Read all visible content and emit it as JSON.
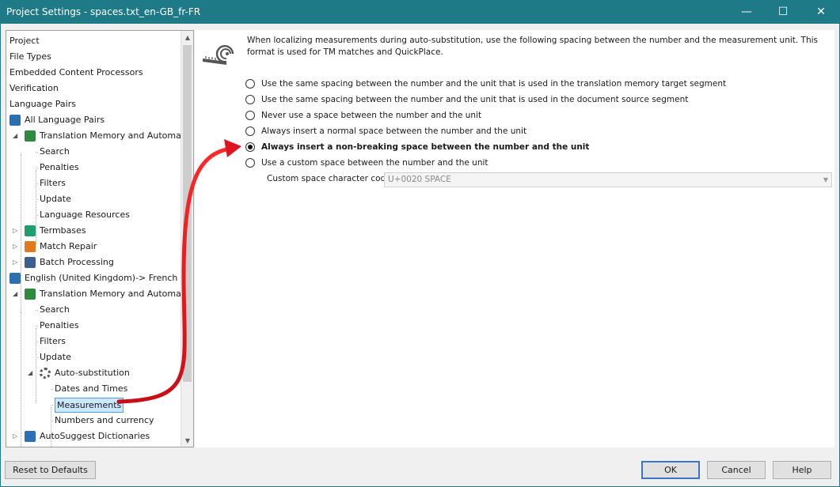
{
  "window": {
    "title": "Project Settings - spaces.txt_en-GB_fr-FR",
    "minimize": "—",
    "maximize": "☐",
    "close": "✕"
  },
  "tree": {
    "items": [
      {
        "label": "Project"
      },
      {
        "label": "File Types"
      },
      {
        "label": "Embedded Content Processors"
      },
      {
        "label": "Verification"
      },
      {
        "label": "Language Pairs"
      },
      {
        "label": "All Language Pairs",
        "icon": "language-pair-icon"
      },
      {
        "label": "Translation Memory and Automate",
        "icon": "translation-memory-icon"
      },
      {
        "label": "Search"
      },
      {
        "label": "Penalties"
      },
      {
        "label": "Filters"
      },
      {
        "label": "Update"
      },
      {
        "label": "Language Resources"
      },
      {
        "label": "Termbases",
        "icon": "termbase-icon"
      },
      {
        "label": "Match Repair",
        "icon": "wrench-icon"
      },
      {
        "label": "Batch Processing",
        "icon": "batch-icon"
      },
      {
        "label": "English (United Kingdom)-> French (Fr",
        "icon": "language-pair-icon"
      },
      {
        "label": "Translation Memory and Automate",
        "icon": "translation-memory-icon"
      },
      {
        "label": "Search"
      },
      {
        "label": "Penalties"
      },
      {
        "label": "Filters"
      },
      {
        "label": "Update"
      },
      {
        "label": "Auto-substitution",
        "icon": "gear-icon"
      },
      {
        "label": "Dates and Times"
      },
      {
        "label": "Measurements"
      },
      {
        "label": "Numbers and currency"
      },
      {
        "label": "AutoSuggest Dictionaries",
        "icon": "dictionary-icon"
      },
      {
        "label": "Match Repair",
        "icon": "wrench-icon"
      }
    ],
    "selected": "Measurements"
  },
  "content": {
    "description": "When localizing measurements during auto-substitution, use the following spacing between the number and the measurement unit. This format is used for TM matches and QuickPlace.",
    "options": [
      {
        "label": "Use the same spacing between the number and the unit that is used in the translation memory target segment",
        "checked": false
      },
      {
        "label": "Use the same spacing between the number and the unit that is used in the document source segment",
        "checked": false
      },
      {
        "label": "Never use a space between the number and the unit",
        "checked": false
      },
      {
        "label": "Always insert a normal space between the number and the unit",
        "checked": false
      },
      {
        "label": "Always insert a non-breaking space between the number and the unit",
        "checked": true
      },
      {
        "label": "Use a custom space between the number and the unit",
        "checked": false
      }
    ],
    "custom_code_label": "Custom space character code:",
    "custom_code_value": "U+0020 SPACE"
  },
  "buttons": {
    "reset": "Reset to Defaults",
    "ok": "OK",
    "cancel": "Cancel",
    "help": "Help"
  },
  "colors": {
    "titlebar": "#1d7a86",
    "arrow": "#e0141e",
    "selection": "#cce8ff"
  }
}
